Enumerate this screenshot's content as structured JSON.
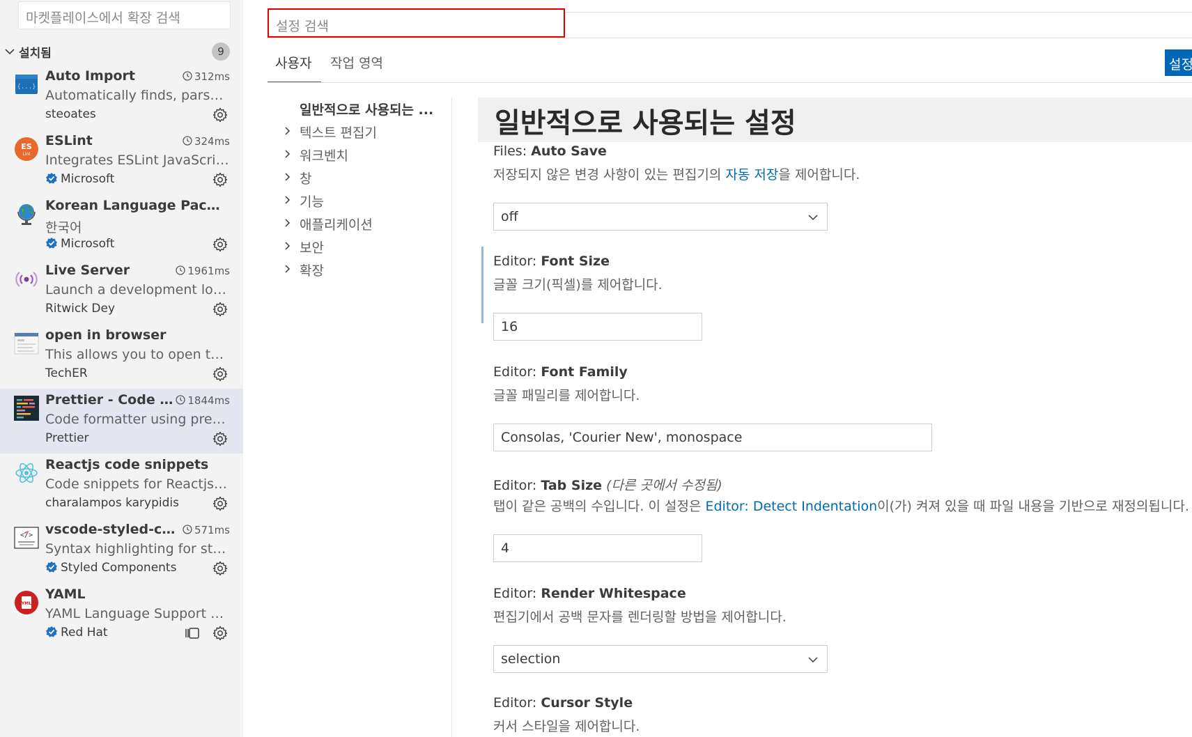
{
  "sidebar": {
    "search_placeholder": "마켓플레이스에서 확장 검색",
    "installed_label": "설치됨",
    "installed_count": "9",
    "extensions": [
      {
        "name": "Auto Import",
        "time": "312ms",
        "description": "Automatically finds, parses a...",
        "publisher": "steoates",
        "verified": false
      },
      {
        "name": "ESLint",
        "time": "324ms",
        "description": "Integrates ESLint JavaScript i...",
        "publisher": "Microsoft",
        "verified": true
      },
      {
        "name": "Korean Language Pack for ...",
        "time": "",
        "description": "한국어",
        "publisher": "Microsoft",
        "verified": true
      },
      {
        "name": "Live Server",
        "time": "1961ms",
        "description": "Launch a development local ...",
        "publisher": "Ritwick Dey",
        "verified": false
      },
      {
        "name": "open in browser",
        "time": "",
        "description": "This allows you to open the c...",
        "publisher": "TechER",
        "verified": false
      },
      {
        "name": "Prettier - Code for...",
        "time": "1844ms",
        "description": "Code formatter using prettier",
        "publisher": "Prettier",
        "verified": false
      },
      {
        "name": "Reactjs code snippets",
        "time": "",
        "description": "Code snippets for Reactjs de...",
        "publisher": "charalampos karypidis",
        "verified": false
      },
      {
        "name": "vscode-styled-com...",
        "time": "571ms",
        "description": "Syntax highlighting for styled...",
        "publisher": "Styled Components",
        "verified": true
      },
      {
        "name": "YAML",
        "time": "",
        "description": "YAML Language Support by ...",
        "publisher": "Red Hat",
        "verified": true
      }
    ]
  },
  "settings": {
    "search_placeholder": "설정 검색",
    "tabs": [
      "사용자",
      "작업 영역"
    ],
    "sync_button": "설정",
    "toc": [
      {
        "label": "일반적으로 사용되는 ...",
        "expandable": false
      },
      {
        "label": "텍스트 편집기",
        "expandable": true
      },
      {
        "label": "워크벤치",
        "expandable": true
      },
      {
        "label": "창",
        "expandable": true
      },
      {
        "label": "기능",
        "expandable": true
      },
      {
        "label": "애플리케이션",
        "expandable": true
      },
      {
        "label": "보안",
        "expandable": true
      },
      {
        "label": "확장",
        "expandable": true
      }
    ],
    "group_title": "일반적으로 사용되는 설정",
    "items": {
      "auto_save": {
        "category": "Files: ",
        "key": "Auto Save",
        "desc_before": "저장되지 않은 변경 사항이 있는 편집기의 ",
        "desc_link": "자동 저장",
        "desc_after": "을 제어합니다.",
        "value": "off"
      },
      "font_size": {
        "category": "Editor: ",
        "key": "Font Size",
        "desc": "글꼴 크기(픽셀)를 제어합니다.",
        "value": "16"
      },
      "font_family": {
        "category": "Editor: ",
        "key": "Font Family",
        "desc": "글꼴 패밀리를 제어합니다.",
        "value": "Consolas, 'Courier New', monospace"
      },
      "tab_size": {
        "category": "Editor: ",
        "key": "Tab Size",
        "modified": "(다른 곳에서 수정됨)",
        "desc_before": "탭이 같은 공백의 수입니다. 이 설정은 ",
        "desc_link": "Editor: Detect Indentation",
        "desc_after": "이(가) 켜져 있을 때 파일 내용을 기반으로 재정의됩니다.",
        "value": "4"
      },
      "render_whitespace": {
        "category": "Editor: ",
        "key": "Render Whitespace",
        "desc": "편집기에서 공백 문자를 렌더링할 방법을 제어합니다.",
        "value": "selection"
      },
      "cursor_style": {
        "category": "Editor: ",
        "key": "Cursor Style",
        "desc": "커서 스타일을 제어합니다."
      }
    }
  },
  "colors": {
    "accent": "#0066b8",
    "link": "#006ab1",
    "search_highlight": "#e00000",
    "sidebar_bg": "#f3f3f3",
    "selected_bg": "#e4e6f1"
  }
}
